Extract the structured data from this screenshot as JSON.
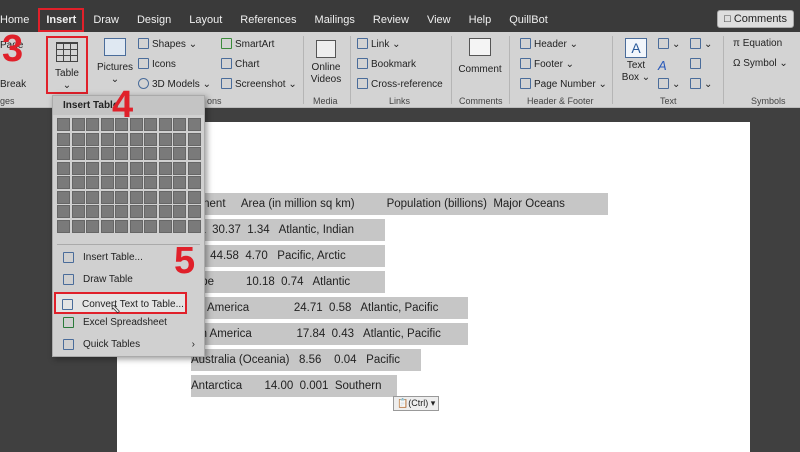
{
  "tabs": [
    "Home",
    "Insert",
    "Draw",
    "Design",
    "Layout",
    "References",
    "Mailings",
    "Review",
    "View",
    "Help",
    "QuillBot"
  ],
  "comments_button": "Comments",
  "ribbon": {
    "page_break": "Break",
    "page_label": "Page",
    "table": "Table",
    "pictures": "Pictures",
    "shapes": "Shapes",
    "icons": "Icons",
    "models": "3D Models",
    "smartart": "SmartArt",
    "chart": "Chart",
    "screenshot": "Screenshot",
    "online_videos": "Online Videos",
    "link": "Link",
    "bookmark": "Bookmark",
    "cross_reference": "Cross-reference",
    "comment": "Comment",
    "header": "Header",
    "footer": "Footer",
    "page_number": "Page Number",
    "text_box": "Text Box",
    "equation": "Equation",
    "symbol": "Symbol",
    "groups": {
      "pages": "ges",
      "illustrations": "ons",
      "media": "Media",
      "links": "Links",
      "comments": "Comments",
      "header_footer": "Header & Footer",
      "text": "Text",
      "symbols": "Symbols"
    }
  },
  "steps": [
    "3",
    "4",
    "5"
  ],
  "menu": {
    "header": "Insert Table",
    "items": [
      "Insert Table...",
      "Draw Table",
      "Convert Text to Table...",
      "Excel Spreadsheet",
      "Quick Tables"
    ],
    "grid_cols": 10,
    "grid_rows": 8
  },
  "document": {
    "lines": [
      "ntinent     Area (in million sq km)          Population (billions)  Major Oceans",
      "ica  30.37  1.34   Atlantic, Indian",
      "a    44.58  4.70   Pacific, Arctic",
      "rope          10.18  0.74   Atlantic",
      "rth America              24.71  0.58   Atlantic, Pacific",
      "uth America              17.84  0.43   Atlantic, Pacific",
      "Australia (Oceania)   8.56    0.04   Pacific",
      "Antarctica       14.00  0.001  Southern"
    ]
  },
  "paste_options": "(Ctrl)"
}
